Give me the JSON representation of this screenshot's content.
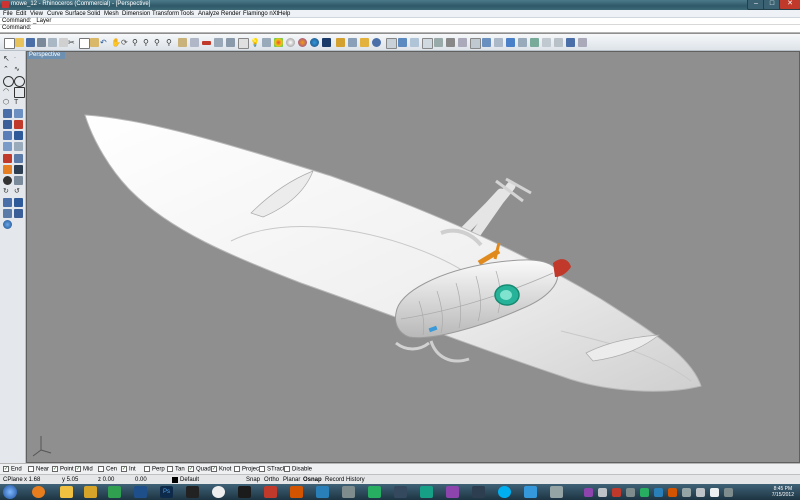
{
  "window": {
    "title": "mowe_12 - Rhinoceros (Commercial) - [Perspective]",
    "buttons": {
      "minimize": "–",
      "maximize": "□",
      "close": "✕"
    }
  },
  "menu": [
    "File",
    "Edit",
    "View",
    "Curve",
    "Surface",
    "Solid",
    "Mesh",
    "Dimension",
    "Transform",
    "Tools",
    "Analyze",
    "Render",
    "Flamingo nXt",
    "Help"
  ],
  "command": {
    "history": "Command: _Layer",
    "prompt": "Command:",
    "value": ""
  },
  "viewport": {
    "tab": "Perspective",
    "background": "#8f8f8f",
    "model_color": "#f2f2f2"
  },
  "osnap": [
    {
      "label": "End",
      "checked": true
    },
    {
      "label": "Near",
      "checked": false
    },
    {
      "label": "Point",
      "checked": true
    },
    {
      "label": "Mid",
      "checked": true
    },
    {
      "label": "Cen",
      "checked": false
    },
    {
      "label": "Int",
      "checked": true
    },
    {
      "label": "Perp",
      "checked": false
    },
    {
      "label": "Tan",
      "checked": false
    },
    {
      "label": "Quad",
      "checked": true
    },
    {
      "label": "Knot",
      "checked": true
    },
    {
      "label": "Project",
      "checked": false
    },
    {
      "label": "STrack",
      "checked": false
    },
    {
      "label": "Disable",
      "checked": false
    }
  ],
  "status": {
    "cplane": "CPlane",
    "x": "x 1.68",
    "y": "y 5.05",
    "z": "z 0.00",
    "extra": "0.00",
    "layer": "Default",
    "panes": [
      "Snap",
      "Ortho",
      "Planar",
      "Osnap",
      "Record History"
    ]
  },
  "taskbar": {
    "time": "8:45 PM",
    "date": "7/15/2012",
    "ps_label": "Ps"
  },
  "icons": {
    "accent": "#6d8fb0",
    "title_bar": "#2f5868",
    "taskbar": "#1d3442"
  }
}
